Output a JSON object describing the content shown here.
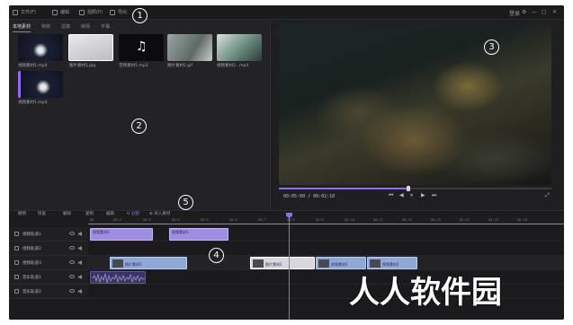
{
  "topbar": {
    "menu": [
      "文件(F)",
      "编辑",
      "拍照(P)",
      "导出"
    ],
    "right": [
      "登录",
      "⚙",
      "—",
      "▢",
      "✕"
    ]
  },
  "steps": [
    "1",
    "2",
    "3",
    "4",
    "5"
  ],
  "media": {
    "tabs": [
      "本地素材",
      "特效",
      "滤镜",
      "转场",
      "字幕"
    ],
    "items": [
      {
        "label": "视频素材1.mp4"
      },
      {
        "label": "图片素材1.jpg"
      },
      {
        "label": "音频素材1.mp3"
      },
      {
        "label": "图片素材2.gif"
      },
      {
        "label": "视频素材2...mp4"
      },
      {
        "label": "视频素材1.mp4"
      }
    ]
  },
  "preview": {
    "time": "00:05:00 / 00:02:10",
    "controls": [
      "⏮",
      "◀",
      "⏸",
      "▶",
      "⏭"
    ],
    "progress": 0.47
  },
  "toolbar": {
    "items": [
      "撤销",
      "恢复",
      "删除",
      "复制",
      "编辑",
      "U 分割",
      "⊕ 添入素材"
    ]
  },
  "timeline": {
    "ruler_ticks": [
      "00",
      "00:2",
      "00:3",
      "00:4",
      "00:5",
      "00:6",
      "00:7",
      "00:8",
      "00:9",
      "00:10",
      "00:11",
      "00:12",
      "00:13",
      "00:14",
      "00:15",
      "00:16"
    ],
    "tracks": [
      {
        "label": "视频轨道1"
      },
      {
        "label": "视频轨道2"
      },
      {
        "label": "视频轨道3"
      },
      {
        "label": "音乐轨道1"
      },
      {
        "label": "音乐轨道2"
      }
    ],
    "clips": {
      "track1": [
        "视频素材1",
        "视频素材1"
      ],
      "track3": [
        "图片素材1",
        "图片素材2",
        "视频素材1",
        "视频素材2"
      ]
    }
  },
  "watermark": "人人软件园"
}
